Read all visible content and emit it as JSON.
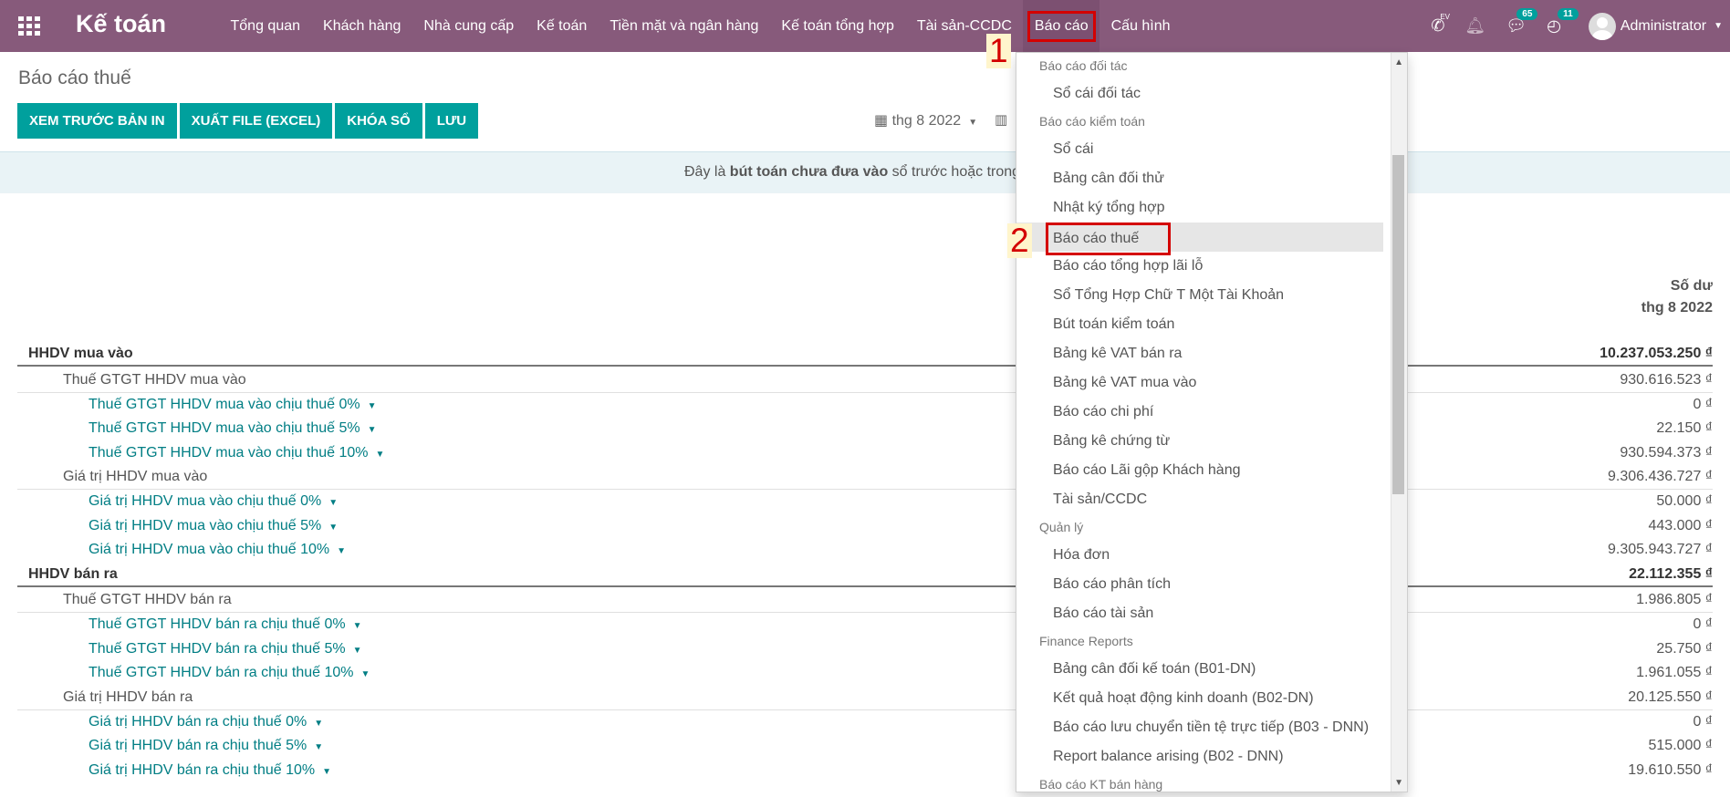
{
  "nav": {
    "brand": "Kế toán",
    "menu": [
      "Tổng quan",
      "Khách hàng",
      "Nhà cung cấp",
      "Kế toán",
      "Tiền mặt và ngân hàng",
      "Kế toán tổng hợp",
      "Tài sản-CCDC",
      "Báo cáo",
      "Cấu hình"
    ],
    "ev_label": "EV",
    "messages_count": "65",
    "activities_count": "11",
    "user": "Administrator"
  },
  "page": {
    "title": "Báo cáo thuế",
    "buttons": [
      "XEM TRƯỚC BẢN IN",
      "XUẤT FILE (EXCEL)",
      "KHÓA SỔ",
      "LƯU"
    ],
    "date_filter": "thg 8 2022",
    "info_prefix": "Đây là ",
    "info_bold": "bút toán chưa đưa vào",
    "info_suffix": " sổ trước hoặc trong",
    "col_head_1": "Số dư",
    "col_head_2": "thg 8 2022"
  },
  "report_rows": [
    {
      "label": "HHDV mua vào",
      "value": "10.237.053.250 ₫",
      "level": 0
    },
    {
      "label": "Thuế GTGT HHDV mua vào",
      "value": "930.616.523 ₫",
      "level": 1
    },
    {
      "label": "Thuế GTGT HHDV mua vào chịu thuế 0%",
      "value": "0 ₫",
      "level": 2
    },
    {
      "label": "Thuế GTGT HHDV mua vào chịu thuế 5%",
      "value": "22.150 ₫",
      "level": 2
    },
    {
      "label": "Thuế GTGT HHDV mua vào chịu thuế 10%",
      "value": "930.594.373 ₫",
      "level": 2
    },
    {
      "label": "Giá trị HHDV mua vào",
      "value": "9.306.436.727 ₫",
      "level": 1
    },
    {
      "label": "Giá trị HHDV mua vào chịu thuế 0%",
      "value": "50.000 ₫",
      "level": 2
    },
    {
      "label": "Giá trị HHDV mua vào chịu thuế 5%",
      "value": "443.000 ₫",
      "level": 2
    },
    {
      "label": "Giá trị HHDV mua vào chịu thuế 10%",
      "value": "9.305.943.727 ₫",
      "level": 2
    },
    {
      "label": "HHDV bán ra",
      "value": "22.112.355 ₫",
      "level": 0
    },
    {
      "label": "Thuế GTGT HHDV bán ra",
      "value": "1.986.805 ₫",
      "level": 1
    },
    {
      "label": "Thuế GTGT HHDV bán ra chịu thuế 0%",
      "value": "0 ₫",
      "level": 2
    },
    {
      "label": "Thuế GTGT HHDV bán ra chịu thuế 5%",
      "value": "25.750 ₫",
      "level": 2
    },
    {
      "label": "Thuế GTGT HHDV bán ra chịu thuế 10%",
      "value": "1.961.055 ₫",
      "level": 2
    },
    {
      "label": "Giá trị HHDV bán ra",
      "value": "20.125.550 ₫",
      "level": 1
    },
    {
      "label": "Giá trị HHDV bán ra chịu thuế 0%",
      "value": "0 ₫",
      "level": 2
    },
    {
      "label": "Giá trị HHDV bán ra chịu thuế 5%",
      "value": "515.000 ₫",
      "level": 2
    },
    {
      "label": "Giá trị HHDV bán ra chịu thuế 10%",
      "value": "19.610.550 ₫",
      "level": 2
    }
  ],
  "dropdown": [
    {
      "type": "section",
      "label": "Báo cáo đối tác"
    },
    {
      "type": "item",
      "label": "Sổ cái đối tác"
    },
    {
      "type": "section",
      "label": "Báo cáo kiểm toán"
    },
    {
      "type": "item",
      "label": "Sổ cái"
    },
    {
      "type": "item",
      "label": "Bảng cân đối thử"
    },
    {
      "type": "item",
      "label": "Nhật ký tổng hợp"
    },
    {
      "type": "item",
      "label": "Báo cáo thuế",
      "active": true
    },
    {
      "type": "item",
      "label": "Báo cáo tổng hợp lãi lỗ"
    },
    {
      "type": "item",
      "label": "Sổ Tổng Hợp Chữ T Một Tài Khoản"
    },
    {
      "type": "item",
      "label": "Bút toán kiểm toán"
    },
    {
      "type": "item",
      "label": "Bảng kê VAT bán ra"
    },
    {
      "type": "item",
      "label": "Bảng kê VAT mua vào"
    },
    {
      "type": "item",
      "label": "Báo cáo chi phí"
    },
    {
      "type": "item",
      "label": "Bảng kê chứng từ"
    },
    {
      "type": "item",
      "label": "Báo cáo Lãi gộp Khách hàng"
    },
    {
      "type": "item",
      "label": "Tài sản/CCDC"
    },
    {
      "type": "section",
      "label": "Quản lý"
    },
    {
      "type": "item",
      "label": "Hóa đơn"
    },
    {
      "type": "item",
      "label": "Báo cáo phân tích"
    },
    {
      "type": "item",
      "label": "Báo cáo tài sản"
    },
    {
      "type": "section",
      "label": "Finance Reports"
    },
    {
      "type": "item",
      "label": "Bảng cân đối kế toán (B01-DN)"
    },
    {
      "type": "item",
      "label": "Kết quả hoạt động kinh doanh (B02-DN)"
    },
    {
      "type": "item",
      "label": "Báo cáo lưu chuyển tiền tệ trực tiếp (B03 - DNN)"
    },
    {
      "type": "item",
      "label": "Report balance arising (B02 - DNN)"
    },
    {
      "type": "section",
      "label": "Báo cáo KT bán hàng"
    }
  ],
  "annotations": {
    "step1": "1",
    "step2": "2"
  }
}
